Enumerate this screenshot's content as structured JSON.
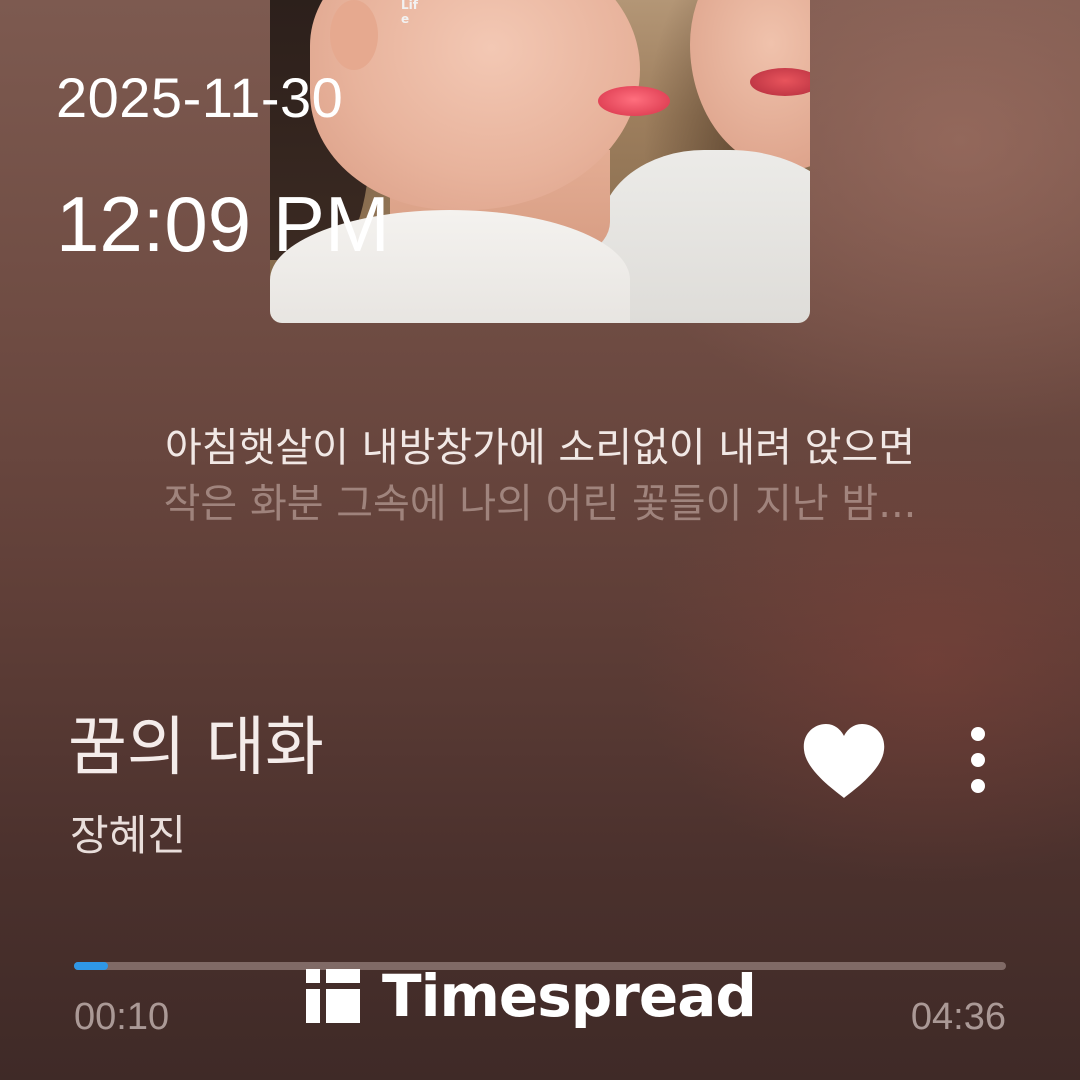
{
  "status": {
    "date": "2025-11-30",
    "time": "12:09 PM"
  },
  "album_art": {
    "cover_text_line1": "Lif",
    "cover_text_line2": "e"
  },
  "lyrics": {
    "current": "아침햇살이 내방창가에 소리없이 내려 앉으면",
    "next": "작은 화분 그속에 나의 어린 꽃들이 지난 밤..."
  },
  "song": {
    "title": "꿈의 대화",
    "artist": "장혜진",
    "liked": true
  },
  "icons": {
    "like": "heart-icon",
    "more": "more-vertical-icon",
    "watermark": "timespread-logo-icon"
  },
  "progress": {
    "elapsed": "00:10",
    "total": "04:36",
    "fraction": 0.036,
    "fill_color": "#2f97e6"
  },
  "watermark": {
    "text": "Timespread"
  }
}
